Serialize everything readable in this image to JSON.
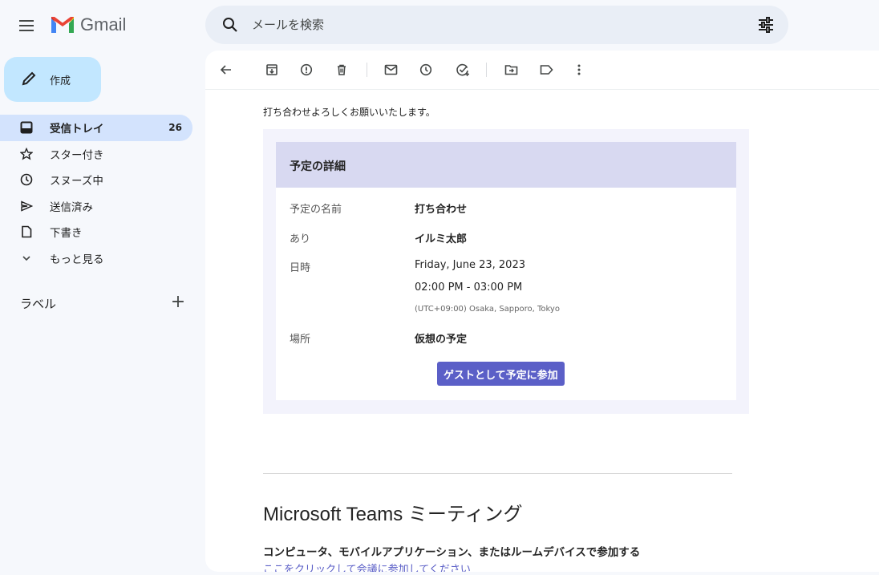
{
  "app": {
    "name": "Gmail"
  },
  "search": {
    "placeholder": "メールを検索"
  },
  "compose": {
    "label": "作成"
  },
  "nav": {
    "items": [
      {
        "label": "受信トレイ",
        "count": "26"
      },
      {
        "label": "スター付き"
      },
      {
        "label": "スヌーズ中"
      },
      {
        "label": "送信済み"
      },
      {
        "label": "下書き"
      },
      {
        "label": "もっと見る"
      }
    ]
  },
  "labels": {
    "header": "ラベル"
  },
  "email": {
    "intro": "打ち合わせよろしくお願いいたします。",
    "card": {
      "title": "予定の詳細",
      "rows": [
        {
          "label": "予定の名前",
          "value": "打ち合わせ"
        },
        {
          "label": "あり",
          "value": "イルミ太郎"
        },
        {
          "label": "日時",
          "date": "Friday, June 23, 2023",
          "time": "02:00 PM - 03:00 PM",
          "tz": "(UTC+09:00) Osaka, Sapporo, Tokyo"
        },
        {
          "label": "場所",
          "value": "仮想の予定"
        }
      ],
      "join_button": "ゲストとして予定に参加"
    },
    "teams": {
      "title": "Microsoft Teams ミーティング",
      "subtitle": "コンピュータ、モバイルアプリケーション、またはルームデバイスで参加する",
      "link": "ここをクリックして会議に参加してください"
    }
  },
  "colors": {
    "accent": "#5b5fc7",
    "nav_active": "#d3e3fd",
    "compose_bg": "#c2e7ff"
  },
  "icons": [
    "menu-icon",
    "gmail-logo",
    "search-icon",
    "tune-icon",
    "pencil-icon",
    "inbox-icon",
    "star-icon",
    "clock-icon",
    "send-icon",
    "draft-icon",
    "chevron-down-icon",
    "plus-icon",
    "back-arrow-icon",
    "archive-icon",
    "report-spam-icon",
    "trash-icon",
    "mail-icon",
    "snooze-icon",
    "add-task-icon",
    "move-to-icon",
    "label-icon",
    "more-vert-icon"
  ]
}
